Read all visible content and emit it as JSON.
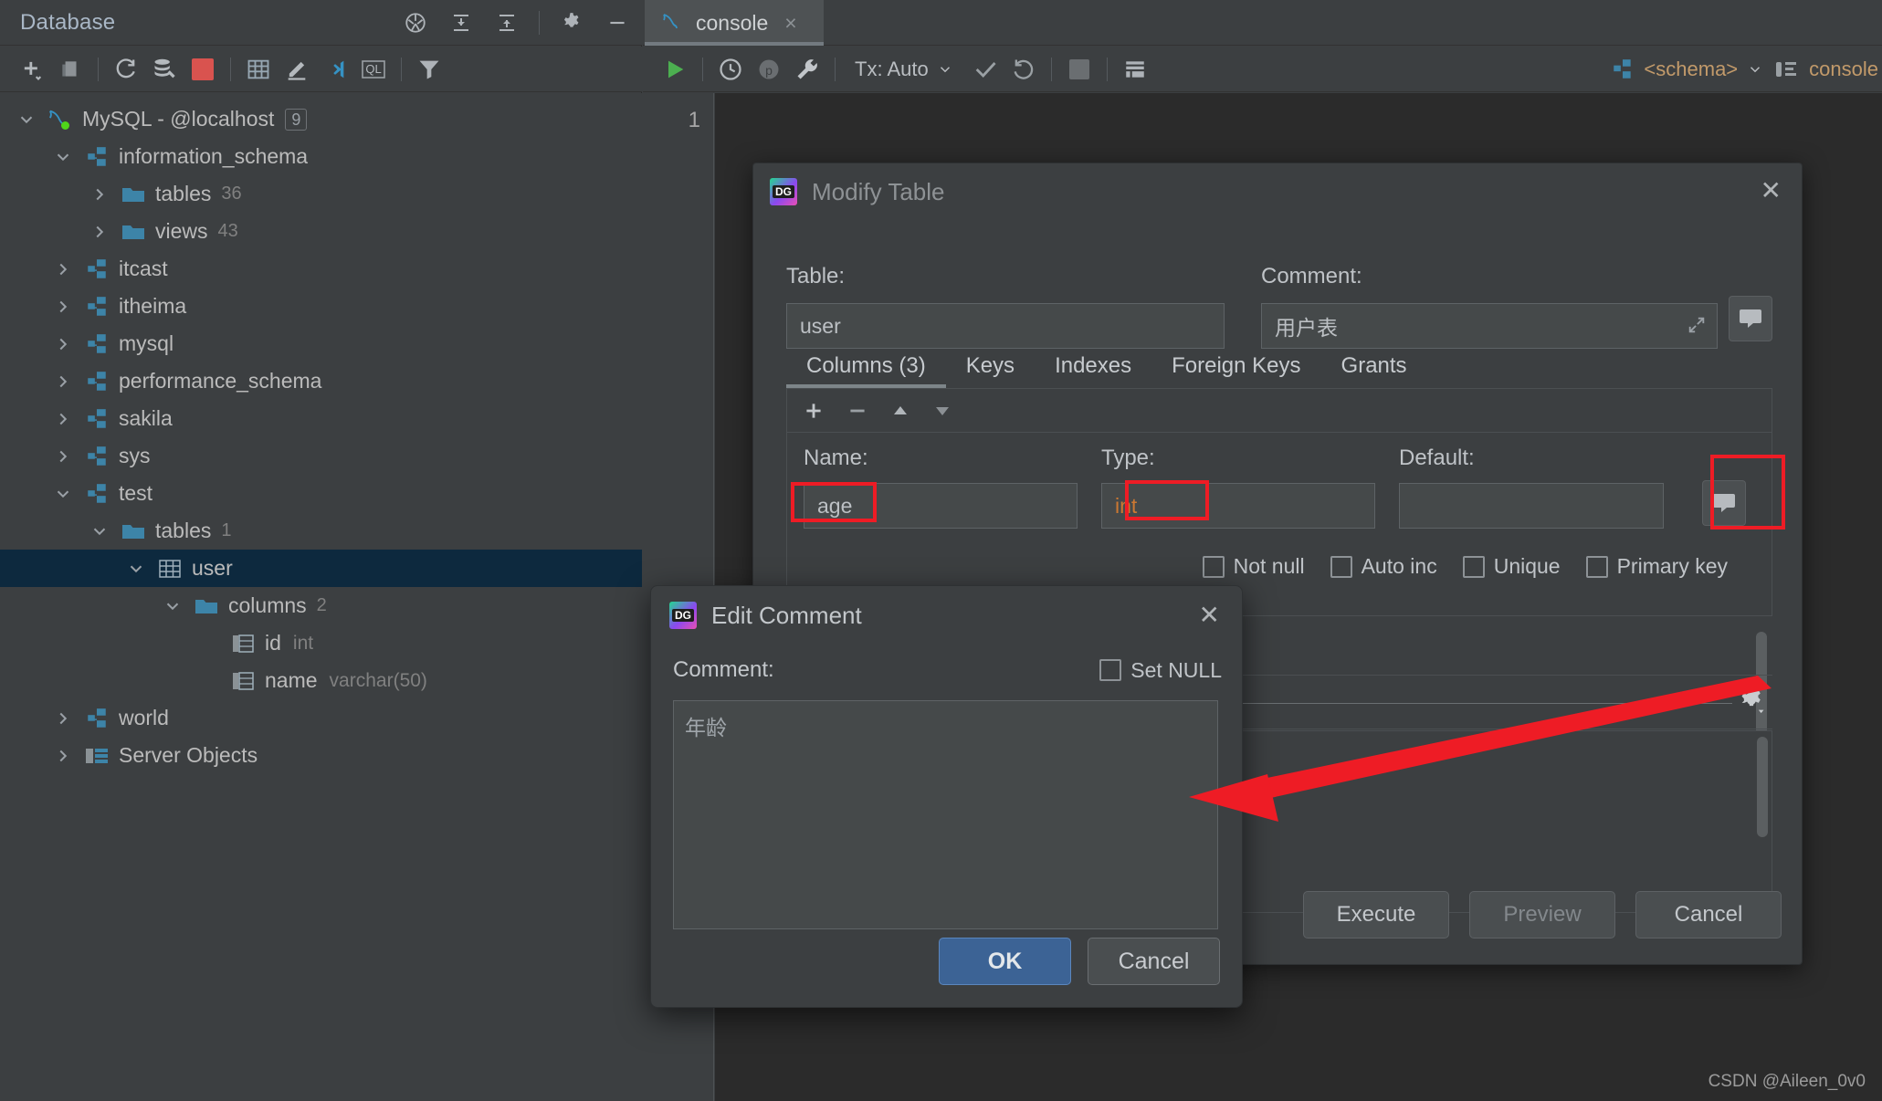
{
  "sidebar": {
    "header": {
      "title": "Database",
      "icons": [
        "pin-icon",
        "expand-all-icon",
        "collapse-all-icon",
        "gear-icon",
        "minimize-icon"
      ]
    },
    "toolbar": {
      "icons": [
        "add-icon",
        "copy-icon",
        "refresh-icon",
        "db-tools-icon",
        "stop-icon",
        "table-icon",
        "edit-icon",
        "jump-to-icon",
        "ql-icon",
        "filter-icon"
      ]
    },
    "tree": [
      {
        "label": "MySQL - @localhost",
        "indent": 0,
        "chevron": "down",
        "icon": "mysql-dolphin-icon",
        "badge": "9",
        "selected": false
      },
      {
        "label": "information_schema",
        "indent": 1,
        "chevron": "down",
        "icon": "schema-icon",
        "selected": false
      },
      {
        "label": "tables",
        "indent": 2,
        "chevron": "right",
        "icon": "folder-icon",
        "count": "36",
        "selected": false
      },
      {
        "label": "views",
        "indent": 2,
        "chevron": "right",
        "icon": "folder-icon",
        "count": "43",
        "selected": false
      },
      {
        "label": "itcast",
        "indent": 1,
        "chevron": "right",
        "icon": "schema-icon",
        "selected": false
      },
      {
        "label": "itheima",
        "indent": 1,
        "chevron": "right",
        "icon": "schema-icon",
        "selected": false
      },
      {
        "label": "mysql",
        "indent": 1,
        "chevron": "right",
        "icon": "schema-icon",
        "selected": false
      },
      {
        "label": "performance_schema",
        "indent": 1,
        "chevron": "right",
        "icon": "schema-icon",
        "selected": false
      },
      {
        "label": "sakila",
        "indent": 1,
        "chevron": "right",
        "icon": "schema-icon",
        "selected": false
      },
      {
        "label": "sys",
        "indent": 1,
        "chevron": "right",
        "icon": "schema-icon",
        "selected": false
      },
      {
        "label": "test",
        "indent": 1,
        "chevron": "down",
        "icon": "schema-icon",
        "selected": false
      },
      {
        "label": "tables",
        "indent": 2,
        "chevron": "down",
        "icon": "folder-icon",
        "count": "1",
        "selected": false
      },
      {
        "label": "user",
        "indent": 3,
        "chevron": "down",
        "icon": "table-icon",
        "selected": true
      },
      {
        "label": "columns",
        "indent": 4,
        "chevron": "down",
        "icon": "folder-icon",
        "count": "2",
        "selected": false
      },
      {
        "label": "id",
        "indent": 5,
        "chevron": "none",
        "icon": "column-icon",
        "type": "int",
        "selected": false
      },
      {
        "label": "name",
        "indent": 5,
        "chevron": "none",
        "icon": "column-icon",
        "type": "varchar(50)",
        "selected": false
      },
      {
        "label": "world",
        "indent": 1,
        "chevron": "right",
        "icon": "schema-icon",
        "selected": false
      },
      {
        "label": "Server Objects",
        "indent": 1,
        "chevron": "right",
        "icon": "server-objects-icon",
        "selected": false
      }
    ]
  },
  "editor": {
    "tab": {
      "label": "console",
      "close": "×",
      "icon": "mysql-dolphin-icon"
    },
    "toolbar": {
      "run_icon": "run-icon",
      "history_icon": "history-icon",
      "profile_icon": "profiler-icon",
      "wrench_icon": "wrench-icon",
      "tx_label": "Tx: Auto",
      "commit_icon": "commit-check-icon",
      "rollback_icon": "rollback-icon",
      "stop_icon": "stop-icon",
      "grid_icon": "grid-icon",
      "schema_selector": "<schema>",
      "session_label": "console",
      "schema_icon": "schema-icon",
      "session_icon": "session-icon"
    },
    "line_number": "1",
    "watermark": "CSDN @Aileen_0v0"
  },
  "modify_dialog": {
    "title": "Modify Table",
    "logo_text": "DG",
    "close_icon": "close-icon",
    "table_label": "Table:",
    "table_value": "user",
    "comment_label": "Comment:",
    "comment_value": "用户表",
    "expand_icon": "expand-editor-icon",
    "comment_button_icon": "comment-bubble-icon",
    "tabs": [
      {
        "label": "Columns (3)",
        "active": true
      },
      {
        "label": "Keys",
        "active": false
      },
      {
        "label": "Indexes",
        "active": false
      },
      {
        "label": "Foreign Keys",
        "active": false
      },
      {
        "label": "Grants",
        "active": false
      }
    ],
    "grid_toolbar": [
      "add-row-icon",
      "remove-row-icon",
      "move-up-icon",
      "move-down-icon"
    ],
    "name_label": "Name:",
    "name_value": "age",
    "type_label": "Type:",
    "type_value": "int",
    "default_label": "Default:",
    "default_value": "",
    "checkboxes": [
      {
        "label": "Not null",
        "checked": false
      },
      {
        "label": "Auto inc",
        "checked": false
      },
      {
        "label": "Unique",
        "checked": false
      },
      {
        "label": "Primary key",
        "checked": false
      }
    ],
    "settings_icon": "gear-dropdown-icon",
    "buttons": [
      {
        "label": "Execute",
        "disabled": false
      },
      {
        "label": "Preview",
        "disabled": true
      },
      {
        "label": "Cancel",
        "disabled": false
      }
    ]
  },
  "comment_dialog": {
    "title": "Edit Comment",
    "logo_text": "DG",
    "close_icon": "close-icon",
    "comment_label": "Comment:",
    "set_null_label": "Set NULL",
    "set_null_checked": false,
    "textarea_value": "年龄",
    "ok_label": "OK",
    "cancel_label": "Cancel"
  },
  "annotations": {
    "highlight_color": "#ee1c25",
    "boxes": [
      "name-field-highlight",
      "type-field-highlight",
      "comment-button-highlight"
    ],
    "arrow": "comment-button-to-textarea-arrow"
  }
}
